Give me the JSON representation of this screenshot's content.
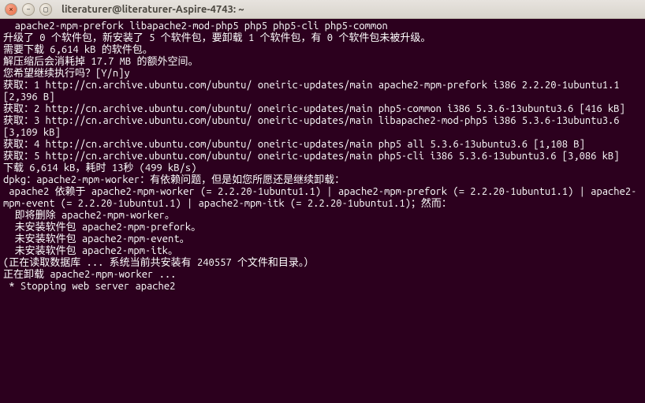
{
  "window": {
    "title": "literaturer@literaturer-Aspire-4743: ~",
    "close_glyph": "×",
    "min_glyph": "–",
    "max_glyph": "▢"
  },
  "terminal": {
    "lines": [
      "  apache2-mpm-prefork libapache2-mod-php5 php5 php5-cli php5-common",
      "升级了 0 个软件包，新安装了 5 个软件包，要卸载 1 个软件包，有 0 个软件包未被升级。",
      "需要下载 6,614 kB 的软件包。",
      "解压缩后会消耗掉 17.7 MB 的额外空间。",
      "您希望继续执行吗？[Y/n]y",
      "获取：1 http://cn.archive.ubuntu.com/ubuntu/ oneiric-updates/main apache2-mpm-prefork i386 2.2.20-1ubuntu1.1 [2,396 B]",
      "获取：2 http://cn.archive.ubuntu.com/ubuntu/ oneiric-updates/main php5-common i386 5.3.6-13ubuntu3.6 [416 kB]",
      "获取：3 http://cn.archive.ubuntu.com/ubuntu/ oneiric-updates/main libapache2-mod-php5 i386 5.3.6-13ubuntu3.6 [3,109 kB]",
      "获取：4 http://cn.archive.ubuntu.com/ubuntu/ oneiric-updates/main php5 all 5.3.6-13ubuntu3.6 [1,108 B]",
      "获取：5 http://cn.archive.ubuntu.com/ubuntu/ oneiric-updates/main php5-cli i386 5.3.6-13ubuntu3.6 [3,086 kB]",
      "下载 6,614 kB，耗时 13秒 (499 kB/s)",
      "dpkg：apache2-mpm-worker：有依赖问题，但是如您所愿还是继续卸载：",
      " apache2 依赖于 apache2-mpm-worker (= 2.2.20-1ubuntu1.1) | apache2-mpm-prefork (= 2.2.20-1ubuntu1.1) | apache2-mpm-event (= 2.2.20-1ubuntu1.1) | apache2-mpm-itk (= 2.2.20-1ubuntu1.1)；然而：",
      "  即将删除 apache2-mpm-worker。",
      "  未安装软件包 apache2-mpm-prefork。",
      "  未安装软件包 apache2-mpm-event。",
      "  未安装软件包 apache2-mpm-itk。",
      "(正在读取数据库 ... 系统当前共安装有 240557 个文件和目录。）",
      "正在卸载 apache2-mpm-worker ...",
      " * Stopping web server apache2"
    ]
  }
}
